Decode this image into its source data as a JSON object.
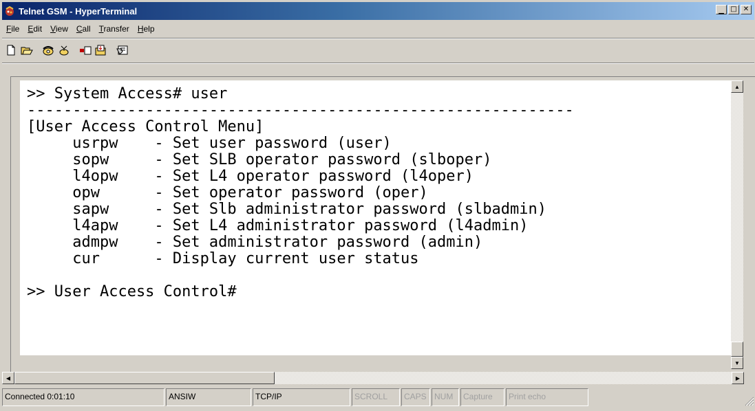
{
  "window": {
    "title": "Telnet GSM - HyperTerminal",
    "controls": {
      "minimize": "_",
      "maximize": "□",
      "close": "×"
    }
  },
  "menu": [
    {
      "label": "File",
      "accel": "F",
      "rest": "ile"
    },
    {
      "label": "Edit",
      "accel": "E",
      "rest": "dit"
    },
    {
      "label": "View",
      "accel": "V",
      "rest": "iew"
    },
    {
      "label": "Call",
      "accel": "C",
      "rest": "all"
    },
    {
      "label": "Transfer",
      "accel": "T",
      "rest": "ransfer"
    },
    {
      "label": "Help",
      "accel": "H",
      "rest": "elp"
    }
  ],
  "toolbar": {
    "icons": [
      "new-icon",
      "open-icon",
      "call-icon",
      "disconnect-icon",
      "send-icon",
      "receive-icon",
      "properties-icon"
    ]
  },
  "terminal": {
    "lines": [
      ">> System Access# user",
      "------------------------------------------------------------",
      "[User Access Control Menu]",
      "     usrpw    - Set user password (user)",
      "     sopw     - Set SLB operator password (slboper)",
      "     l4opw    - Set L4 operator password (l4oper)",
      "     opw      - Set operator password (oper)",
      "     sapw     - Set Slb administrator password (slbadmin)",
      "     l4apw    - Set L4 administrator password (l4admin)",
      "     admpw    - Set administrator password (admin)",
      "     cur      - Display current user status",
      "",
      ">> User Access Control#"
    ]
  },
  "status": {
    "connected": "Connected 0:01:10",
    "emulation": "ANSIW",
    "protocol": "TCP/IP",
    "scroll": "SCROLL",
    "caps": "CAPS",
    "num": "NUM",
    "capture": "Capture",
    "print_echo": "Print echo"
  },
  "colors": {
    "title_start": "#0a246a",
    "title_end": "#a6caf0",
    "chrome": "#d4d0c8",
    "terminal_bg": "#ffffff"
  }
}
